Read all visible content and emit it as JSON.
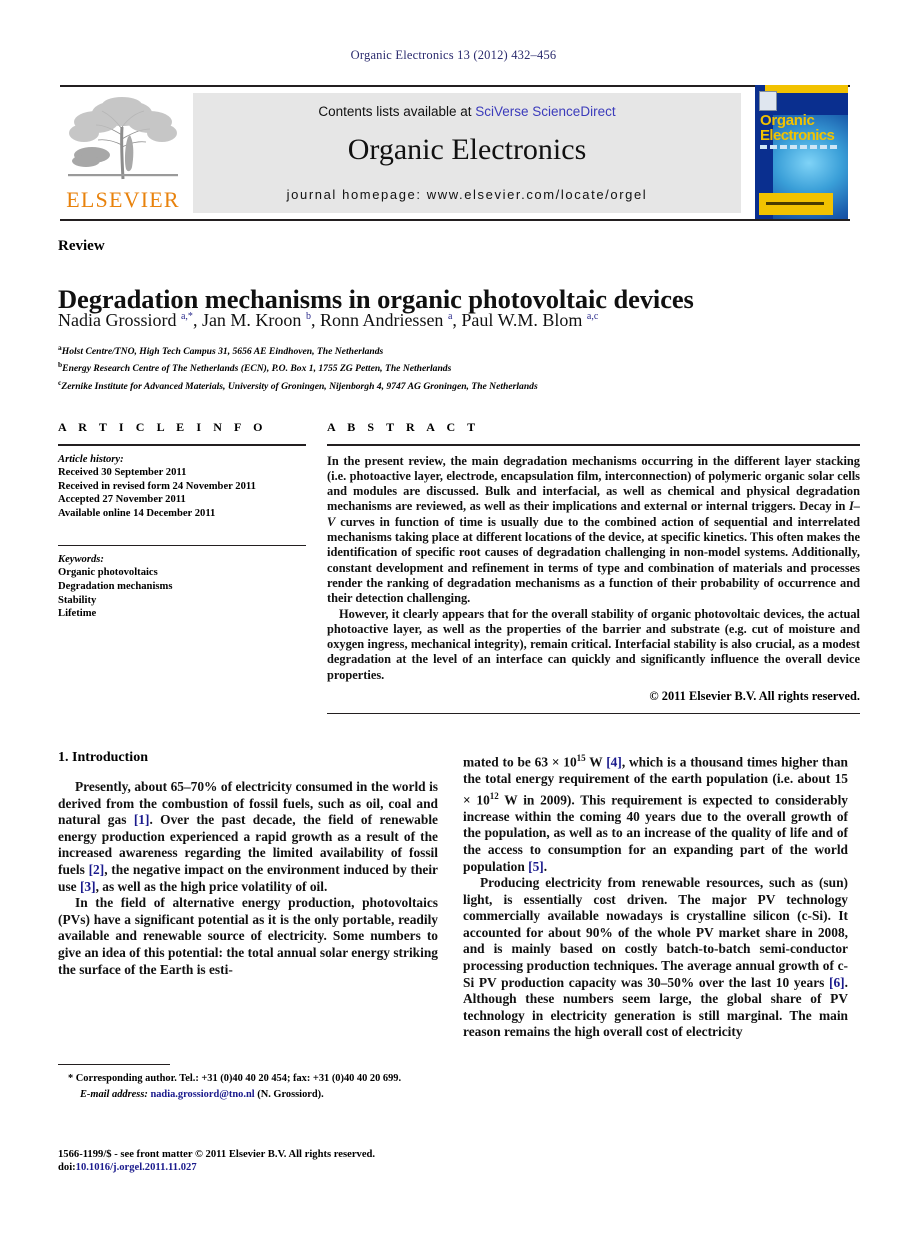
{
  "running_head": "Organic Electronics 13 (2012) 432–456",
  "masthead": {
    "contents_prefix": "Contents lists available at",
    "sciencedirect": "SciVerse ScienceDirect",
    "journal_title": "Organic Electronics",
    "homepage": "journal homepage: www.elsevier.com/locate/orgel",
    "publisher_wordmark": "ELSEVIER",
    "cover": {
      "line1": "Organic",
      "line2": "Electronics"
    },
    "colors": {
      "link_blue": "#3b3bbb",
      "elsevier_orange": "#e8820c",
      "cover_blue": "#0a2f8f",
      "cover_yellow": "#f2c200",
      "band_grey": "#e6e6e6"
    }
  },
  "article": {
    "type_label": "Review",
    "title": "Degradation mechanisms in organic photovoltaic devices",
    "authors_html": "Nadia Grossiord <sup>a,*</sup>, Jan M. Kroon <sup>b</sup>, Ronn Andriessen <sup>a</sup>, Paul W.M. Blom <sup>a,c</sup>",
    "affiliations": [
      {
        "marker": "a",
        "text": "Holst Centre/TNO, High Tech Campus 31, 5656 AE Eindhoven, The Netherlands"
      },
      {
        "marker": "b",
        "text": "Energy Research Centre of The Netherlands (ECN), P.O. Box 1, 1755 ZG Petten, The Netherlands"
      },
      {
        "marker": "c",
        "text": "Zernike Institute for Advanced Materials, University of Groningen, Nijenborgh 4, 9747 AG Groningen, The Netherlands"
      }
    ]
  },
  "article_info": {
    "heading": "A R T I C L E   I N F O",
    "history_label": "Article history:",
    "history": [
      "Received 30 September 2011",
      "Received in revised form 24 November 2011",
      "Accepted 27 November 2011",
      "Available online 14 December 2011"
    ],
    "keywords_label": "Keywords:",
    "keywords": [
      "Organic photovoltaics",
      "Degradation mechanisms",
      "Stability",
      "Lifetime"
    ]
  },
  "abstract": {
    "heading": "A B S T R A C T",
    "paragraph1_html": "In the present review, the main degradation mechanisms occurring in the different layer stacking (i.e. photoactive layer, electrode, encapsulation film, interconnection) of polymeric organic solar cells and modules are discussed. Bulk and interfacial, as well as chemical and physical degradation mechanisms are reviewed, as well as their implications and external or internal triggers. Decay in <span class=\"iv\">I–V</span> curves in function of time is usually due to the combined action of sequential and interrelated mechanisms taking place at different locations of the device, at specific kinetics. This often makes the identification of specific root causes of degradation challenging in non-model systems. Additionally, constant development and refinement in terms of type and combination of materials and processes render the ranking of degradation mechanisms as a function of their probability of occurrence and their detection challenging.",
    "paragraph2_html": "However, it clearly appears that for the overall stability of organic photovoltaic devices, the actual photoactive layer, as well as the properties of the barrier and substrate (e.g. cut of moisture and oxygen ingress, mechanical integrity), remain critical. Interfacial stability is also crucial, as a modest degradation at the level of an interface can quickly and significantly influence the overall device properties.",
    "copyright": "© 2011 Elsevier B.V. All rights reserved."
  },
  "body": {
    "section_heading": "1. Introduction",
    "left_column_html": [
      "Presently, about 65–70% of electricity consumed in the world is derived from the combustion of fossil fuels, such as oil, coal and natural gas <span class=\"ref\">[1]</span>. Over the past decade, the field of renewable energy production experienced a rapid growth as a result of the increased awareness regarding the limited availability of fossil fuels <span class=\"ref\">[2]</span>, the negative impact on the environment induced by their use <span class=\"ref\">[3]</span>, as well as the high price volatility of oil.",
      "In the field of alternative energy production, photovoltaics (PVs) have a significant potential as it is the only portable, readily available and renewable source of electricity. Some numbers to give an idea of this potential: the total annual solar energy striking the surface of the Earth is esti-"
    ],
    "right_column_html": [
      "mated to be 63 × 10<sup>15</sup> W <span class=\"ref\">[4]</span>, which is a thousand times higher than the total energy requirement of the earth population (i.e. about 15 × 10<sup>12</sup> W in 2009). This requirement is expected to considerably increase within the coming 40 years due to the overall growth of the population, as well as to an increase of the quality of life and of the access to consumption for an expanding part of the world population <span class=\"ref\">[5]</span>.",
      "Producing electricity from renewable resources, such as (sun) light, is essentially cost driven. The major PV technology commercially available nowadays is crystalline silicon (c-Si). It accounted for about 90% of the whole PV market share in 2008, and is mainly based on costly batch-to-batch semi-conductor processing production techniques. The average annual growth of c-Si PV production capacity was 30–50% over the last 10 years <span class=\"ref\">[6]</span>. Although these numbers seem large, the global share of PV technology in electricity generation is still marginal. The main reason remains the high overall cost of electricity"
    ]
  },
  "footnote": {
    "corresponding_html": "* Corresponding author. Tel.: +31 (0)40 40 20 454; fax: +31 (0)40 40 20 699.",
    "email_label": "E-mail address:",
    "email": "nadia.grossiord@tno.nl",
    "email_owner": "(N. Grossiord)."
  },
  "imprint": {
    "issn_line": "1566-1199/$ - see front matter © 2011 Elsevier B.V. All rights reserved.",
    "doi_prefix": "doi:",
    "doi": "10.1016/j.orgel.2011.11.027"
  }
}
